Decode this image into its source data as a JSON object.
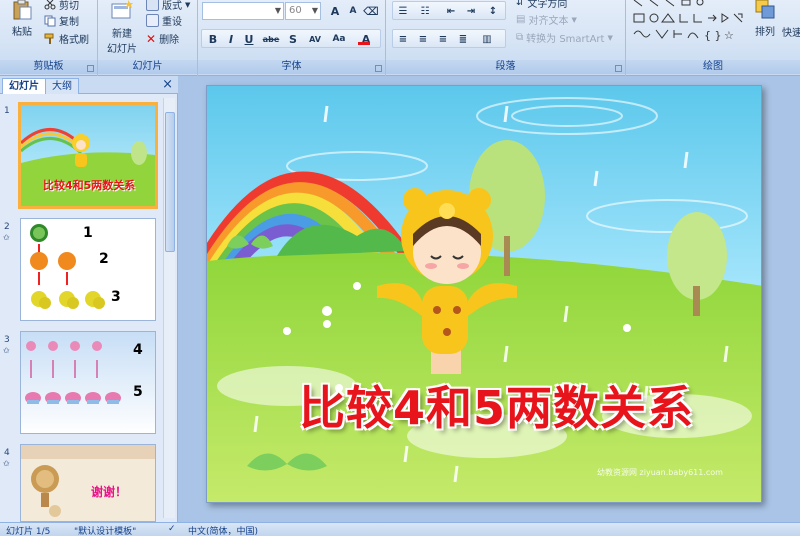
{
  "ribbon": {
    "clipboard": {
      "label": "剪贴板",
      "paste": "粘贴",
      "cut": "剪切",
      "copy": "复制",
      "format_painter": "格式刷"
    },
    "slides": {
      "label": "幻灯片",
      "new_slide_line1": "新建",
      "new_slide_line2": "幻灯片",
      "layout": "版式",
      "reset": "重设",
      "delete": "删除"
    },
    "font": {
      "label": "字体",
      "font_size": "60",
      "bold": "B",
      "italic": "I",
      "underline": "U",
      "strike": "abe",
      "shadow": "S",
      "spacing": "AV",
      "change_case": "Aa",
      "font_color": "A",
      "grow": "A",
      "shrink": "A"
    },
    "paragraph": {
      "label": "段落",
      "text_direction": "文字方向",
      "align_text": "对齐文本",
      "convert_smartart": "转换为 SmartArt"
    },
    "drawing": {
      "label": "绘图",
      "arrange": "排列",
      "quick_styles": "快速"
    }
  },
  "leftpane": {
    "tab_slides": "幻灯片",
    "tab_outline": "大纲",
    "close": "×",
    "slides": [
      {
        "num": "1",
        "title": "比较4和5两数关系"
      },
      {
        "num": "2",
        "labels": [
          "1",
          "2",
          "3"
        ]
      },
      {
        "num": "3",
        "labels": [
          "4",
          "5"
        ]
      },
      {
        "num": "4",
        "text": "谢谢！"
      }
    ]
  },
  "slide": {
    "title": "比较4和5两数关系",
    "watermark": "幼教资源网 ziyuan.baby611.com"
  },
  "statusbar": {
    "slide_count": "幻灯片 1/5",
    "theme": "\"默认设计模板\"",
    "language": "中文(简体，中国)"
  },
  "colors": {
    "accent": "#15428b",
    "title_red": "#e8141b",
    "selection": "#f9b03c"
  }
}
